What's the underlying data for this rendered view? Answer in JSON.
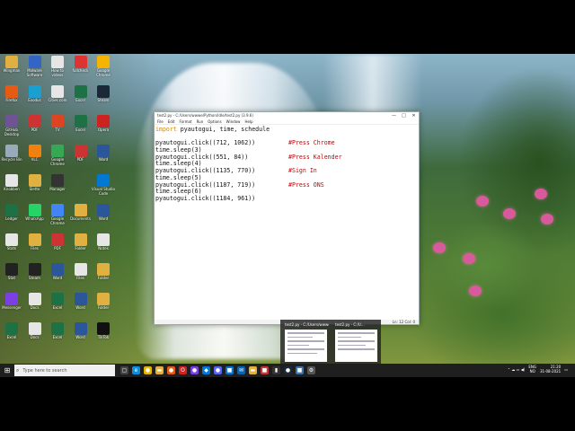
{
  "desktop": {
    "icons": [
      {
        "label": "Wingman",
        "color": "#e0b040",
        "col": 0,
        "row": 0
      },
      {
        "label": "Malware Software Tool",
        "color": "#3465c4",
        "col": 1,
        "row": 0
      },
      {
        "label": "How to videos",
        "color": "#e6e6e6",
        "col": 2,
        "row": 0
      },
      {
        "label": "fullcheck",
        "color": "#d33",
        "col": 3,
        "row": 0
      },
      {
        "label": "Google Chrome",
        "color": "#f4b400",
        "col": 4,
        "row": 0
      },
      {
        "label": "Firefox",
        "color": "#e55b13",
        "col": 0,
        "row": 1
      },
      {
        "label": "Exodus",
        "color": "#1a9fd1",
        "col": 1,
        "row": 1
      },
      {
        "label": "Cities.com",
        "color": "#e6e6e6",
        "col": 2,
        "row": 1
      },
      {
        "label": "Excel",
        "color": "#1e7145",
        "col": 3,
        "row": 1
      },
      {
        "label": "Steam",
        "color": "#1b2838",
        "col": 4,
        "row": 1
      },
      {
        "label": "GitHub Desktop",
        "color": "#6e5494",
        "col": 0,
        "row": 2
      },
      {
        "label": "PDF",
        "color": "#c33",
        "col": 1,
        "row": 2
      },
      {
        "label": "TV",
        "color": "#d42",
        "col": 2,
        "row": 2
      },
      {
        "label": "Excel",
        "color": "#1e7145",
        "col": 3,
        "row": 2
      },
      {
        "label": "Opera",
        "color": "#c22",
        "col": 4,
        "row": 2
      },
      {
        "label": "Recycle Bin",
        "color": "#9ab",
        "col": 0,
        "row": 3
      },
      {
        "label": "VLC",
        "color": "#f08010",
        "col": 1,
        "row": 3
      },
      {
        "label": "Google Chrome",
        "color": "#34a853",
        "col": 2,
        "row": 3
      },
      {
        "label": "PDF",
        "color": "#c33",
        "col": 3,
        "row": 3
      },
      {
        "label": "Word",
        "color": "#2b579a",
        "col": 4,
        "row": 3
      },
      {
        "label": "Knobben",
        "color": "#e6e6e6",
        "col": 0,
        "row": 4
      },
      {
        "label": "Slette",
        "color": "#e0b040",
        "col": 1,
        "row": 4
      },
      {
        "label": "Manager",
        "color": "#333",
        "col": 2,
        "row": 4
      },
      {
        "label": "Visual Studio Code",
        "color": "#0078d4",
        "col": 4,
        "row": 4
      },
      {
        "label": "Ledger",
        "color": "#1e7145",
        "col": 0,
        "row": 5
      },
      {
        "label": "WhatsApp",
        "color": "#25d366",
        "col": 1,
        "row": 5
      },
      {
        "label": "Google Chrome",
        "color": "#4285f4",
        "col": 2,
        "row": 5
      },
      {
        "label": "Documents",
        "color": "#e0b040",
        "col": 3,
        "row": 5
      },
      {
        "label": "Word",
        "color": "#2b579a",
        "col": 4,
        "row": 5
      },
      {
        "label": "Stats",
        "color": "#e6e6e6",
        "col": 0,
        "row": 6
      },
      {
        "label": "Files",
        "color": "#e0b040",
        "col": 1,
        "row": 6
      },
      {
        "label": "PDF",
        "color": "#c33",
        "col": 2,
        "row": 6
      },
      {
        "label": "Folder",
        "color": "#e0b040",
        "col": 3,
        "row": 6
      },
      {
        "label": "Notes",
        "color": "#e6e6e6",
        "col": 4,
        "row": 6
      },
      {
        "label": "Stat",
        "color": "#222",
        "col": 0,
        "row": 7
      },
      {
        "label": "Steam",
        "color": "#222",
        "col": 1,
        "row": 7
      },
      {
        "label": "Word",
        "color": "#2b579a",
        "col": 2,
        "row": 7
      },
      {
        "label": "Files",
        "color": "#e6e6e6",
        "col": 3,
        "row": 7
      },
      {
        "label": "Folder",
        "color": "#e0b040",
        "col": 4,
        "row": 7
      },
      {
        "label": "Messenger",
        "color": "#7b3fe4",
        "col": 0,
        "row": 8
      },
      {
        "label": "Docs",
        "color": "#e6e6e6",
        "col": 1,
        "row": 8
      },
      {
        "label": "Excel",
        "color": "#1e7145",
        "col": 2,
        "row": 8
      },
      {
        "label": "Word",
        "color": "#2b579a",
        "col": 3,
        "row": 8
      },
      {
        "label": "Folder",
        "color": "#e0b040",
        "col": 4,
        "row": 8
      },
      {
        "label": "Excel",
        "color": "#1e7145",
        "col": 0,
        "row": 9
      },
      {
        "label": "Docs",
        "color": "#e6e6e6",
        "col": 1,
        "row": 9
      },
      {
        "label": "Excel",
        "color": "#1e7145",
        "col": 2,
        "row": 9
      },
      {
        "label": "Word",
        "color": "#2b579a",
        "col": 3,
        "row": 9
      },
      {
        "label": "TikTok",
        "color": "#111",
        "col": 4,
        "row": 9
      }
    ]
  },
  "window": {
    "title": "test2.py - C:/Users/wwwe/Python/Idle/test2.py (3.9.6)",
    "controls": {
      "minimize": "—",
      "maximize": "□",
      "close": "✕"
    },
    "menu": [
      "File",
      "Edit",
      "Format",
      "Run",
      "Options",
      "Window",
      "Help"
    ],
    "code": [
      {
        "kw": "import",
        "text": " pyautogui, time, schedule",
        "comment": ""
      },
      {
        "kw": "",
        "text": "",
        "comment": ""
      },
      {
        "kw": "",
        "text": "pyautogui.click((712, 1062))",
        "comment": "#Press Chrome"
      },
      {
        "kw": "",
        "text": "time.sleep(3)",
        "comment": ""
      },
      {
        "kw": "",
        "text": "pyautogui.click((551, 84))",
        "comment": "#Press Kalender"
      },
      {
        "kw": "",
        "text": "time.sleep(4)",
        "comment": ""
      },
      {
        "kw": "",
        "text": "pyautogui.click((1135, 770))",
        "comment": "#Sign In"
      },
      {
        "kw": "",
        "text": "time.sleep(5)",
        "comment": ""
      },
      {
        "kw": "",
        "text": "pyautogui.click((1187, 719))",
        "comment": "#Press ONS"
      },
      {
        "kw": "",
        "text": "time.sleep(6)",
        "comment": ""
      },
      {
        "kw": "",
        "text": "pyautogui.click((1184, 961))",
        "comment": ""
      }
    ],
    "status": "Ln: 12   Col: 0"
  },
  "thumbnails": [
    {
      "title": "test2.py - C:/Users/wwwe..."
    },
    {
      "title": "test2.py - C:/U..."
    }
  ],
  "taskbar": {
    "start_icon": "⊞",
    "search_icon": "⌕",
    "search_placeholder": "Type here to search",
    "apps": [
      {
        "name": "task-view",
        "color": "#444",
        "glyph": "▢"
      },
      {
        "name": "edge",
        "color": "#0c8ee0",
        "glyph": "e"
      },
      {
        "name": "chrome",
        "color": "#e8b400",
        "glyph": "●"
      },
      {
        "name": "explorer",
        "color": "#e0b040",
        "glyph": "▬"
      },
      {
        "name": "firefox",
        "color": "#e55b13",
        "glyph": "●"
      },
      {
        "name": "opera",
        "color": "#c22",
        "glyph": "O"
      },
      {
        "name": "messenger",
        "color": "#7b3fe4",
        "glyph": "●"
      },
      {
        "name": "vscode",
        "color": "#0078d4",
        "glyph": "◆"
      },
      {
        "name": "discord",
        "color": "#5865f2",
        "glyph": "●"
      },
      {
        "name": "store",
        "color": "#0078d4",
        "glyph": "■"
      },
      {
        "name": "mail",
        "color": "#0a64ad",
        "glyph": "✉"
      },
      {
        "name": "folder",
        "color": "#e0b040",
        "glyph": "▬"
      },
      {
        "name": "pdf",
        "color": "#c33",
        "glyph": "■"
      },
      {
        "name": "terminal",
        "color": "#333",
        "glyph": "▮"
      },
      {
        "name": "steam",
        "color": "#1b2838",
        "glyph": "●"
      },
      {
        "name": "python-idle",
        "color": "#3b74a8",
        "glyph": "■"
      },
      {
        "name": "settings",
        "color": "#555",
        "glyph": "⚙"
      }
    ],
    "tray": {
      "lang": "ENG",
      "region": "NO",
      "time": "21:20",
      "date": "31-08-2021"
    }
  }
}
